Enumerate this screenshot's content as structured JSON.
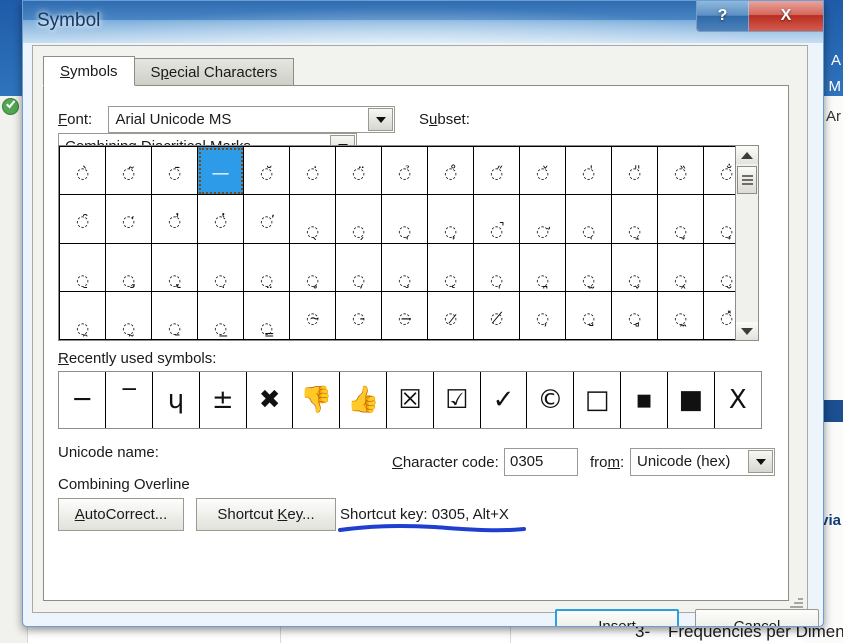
{
  "window": {
    "title": "Symbol",
    "help_button": "?",
    "close_button": "X"
  },
  "tabs": [
    {
      "label": "Symbols",
      "underline_index": 0,
      "active": true
    },
    {
      "label": "Special Characters",
      "underline_index": 9,
      "active": false
    }
  ],
  "font_field": {
    "label": "Font:",
    "label_underline": "F",
    "value": "Arial Unicode MS"
  },
  "subset_field": {
    "label": "Subset:",
    "label_underline": "u",
    "value": "Combining Diacritical Marks"
  },
  "symbol_grid": {
    "columns": 15,
    "rows": 4,
    "selected_row": 0,
    "selected_col": 3,
    "glyphs": [
      [
        "̀",
        "̃",
        "̄",
        "̅",
        "̆",
        "̇",
        "̈",
        "̉",
        "̊",
        "̋",
        "̌",
        "̍",
        "̎",
        "̏",
        "̐"
      ],
      [
        "̑",
        "̒",
        "̓",
        "̔",
        "̕",
        "̖",
        "̗",
        "̘",
        "̙",
        "̚",
        "̛",
        "̜",
        "̝",
        "̞",
        "̟"
      ],
      [
        "̠",
        "̡",
        "̢",
        "̣",
        "̤",
        "̥",
        "̦",
        "̧",
        "̨",
        "̩",
        "̪",
        "̫",
        "̬",
        "̭",
        "̮"
      ],
      [
        "̯",
        "̰",
        "̱",
        "̲",
        "̳",
        "̴",
        "̵",
        "̶",
        "̷",
        "̸",
        "̹",
        "̺",
        "̻",
        "̼",
        "̽"
      ]
    ]
  },
  "scrollbar": {
    "up_arrow": "▲",
    "down_arrow": "▼"
  },
  "recent": {
    "label": "Recently used symbols:",
    "label_underline": "R",
    "symbols": [
      "─",
      "‾",
      "ɥ",
      "±",
      "✖",
      "👎",
      "👍",
      "☒",
      "☑",
      "✓",
      "©",
      "□",
      "▪",
      "■",
      "X"
    ]
  },
  "unicode_name": {
    "label": "Unicode name:",
    "value": "Combining Overline"
  },
  "character_code": {
    "label": "Character code:",
    "label_underline": "C",
    "value": "0305"
  },
  "from_field": {
    "label": "from:",
    "label_underline": "m",
    "value": "Unicode (hex)"
  },
  "buttons": {
    "autocorrect": "AutoCorrect...",
    "autocorrect_underline": "A",
    "shortcut_key": "Shortcut Key...",
    "shortcut_key_underline": "K",
    "insert": "Insert",
    "insert_underline": "I",
    "cancel": "Cancel"
  },
  "shortcut_status": "Shortcut key: 0305, Alt+X",
  "annotation": {
    "type": "hand-drawn-underline",
    "color": "#1f3fd0",
    "target": "Shortcut key: 0305, Alt+X"
  },
  "background": {
    "bottom_number": "3-",
    "bottom_heading": "Frequencies per Dimension",
    "right_fragments": [
      "A",
      "M",
      "Ar",
      "via"
    ]
  },
  "colors": {
    "title_blue": "#2f6cb0",
    "close_red": "#b92d22",
    "selection_blue": "#2e9be8",
    "focus_border": "#2b9fe0",
    "annotation_blue": "#1f3fd0"
  }
}
